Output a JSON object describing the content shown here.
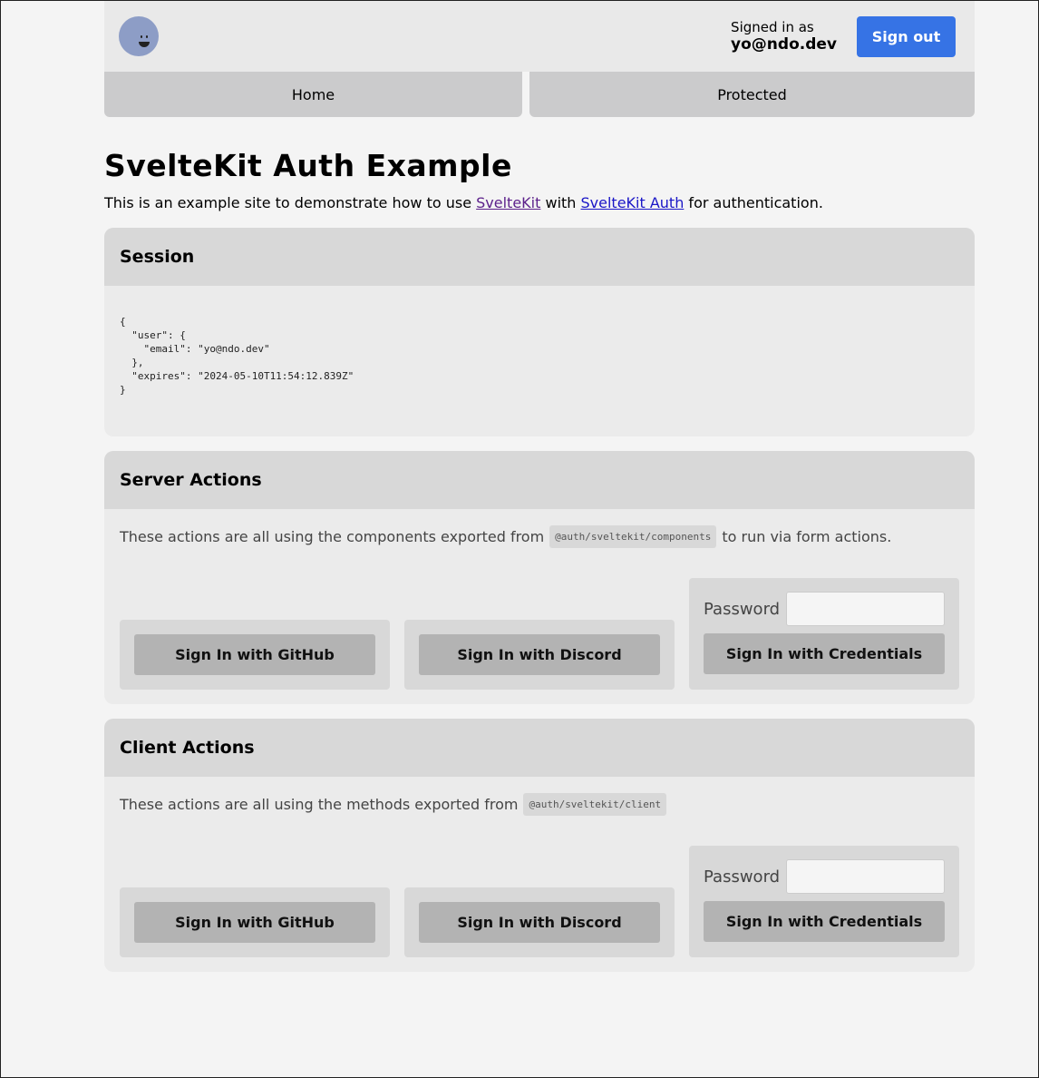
{
  "header": {
    "signed_in_label": "Signed in as",
    "user_email": "yo@ndo.dev",
    "sign_out_label": "Sign out"
  },
  "nav": {
    "home": "Home",
    "protected": "Protected"
  },
  "main": {
    "title": "SvelteKit Auth Example",
    "intro_before": "This is an example site to demonstrate how to use ",
    "link_sveltekit": "SvelteKit",
    "intro_mid": " with ",
    "link_sveltekit_auth": "SvelteKit Auth",
    "intro_after": " for authentication."
  },
  "session": {
    "title": "Session",
    "json": "{\n  \"user\": {\n    \"email\": \"yo@ndo.dev\"\n  },\n  \"expires\": \"2024-05-10T11:54:12.839Z\"\n}"
  },
  "server_actions": {
    "title": "Server Actions",
    "desc_before": "These actions are all using the components exported from",
    "code": "@auth/sveltekit/components",
    "desc_after": "to run via form actions.",
    "github_label": "Sign In with GitHub",
    "discord_label": "Sign In with Discord",
    "password_label": "Password",
    "credentials_label": "Sign In with Credentials"
  },
  "client_actions": {
    "title": "Client Actions",
    "desc_before": "These actions are all using the methods exported from",
    "code": "@auth/sveltekit/client",
    "github_label": "Sign In with GitHub",
    "discord_label": "Sign In with Discord",
    "password_label": "Password",
    "credentials_label": "Sign In with Credentials"
  },
  "colors": {
    "accent": "#3673e5",
    "avatar": "#8d9dc6"
  }
}
